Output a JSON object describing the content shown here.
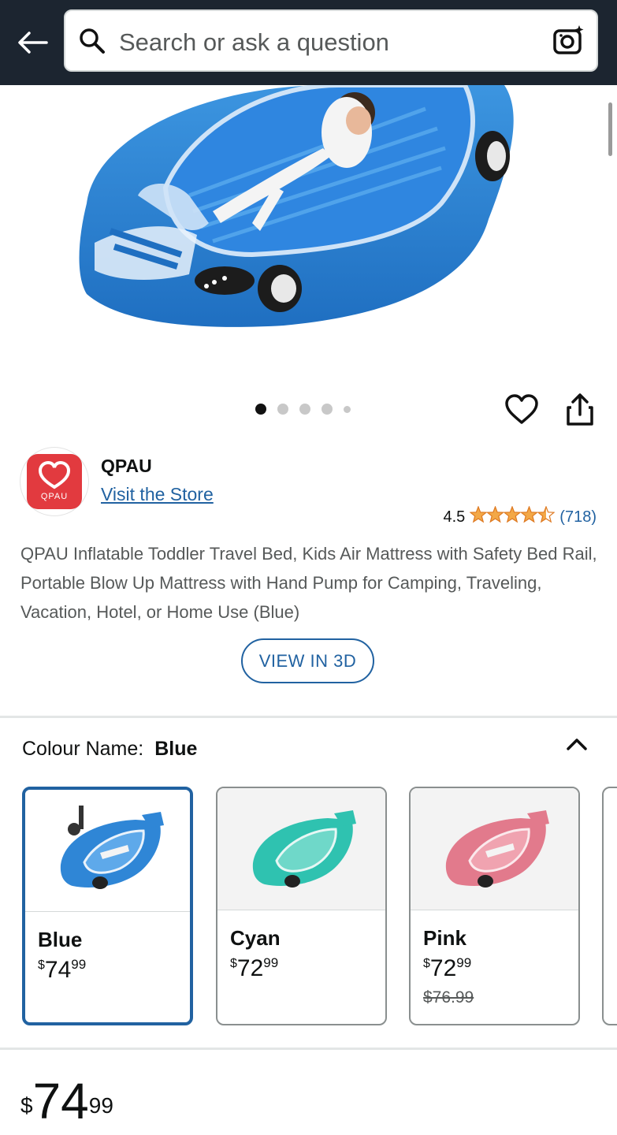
{
  "search": {
    "placeholder": "Search or ask a question"
  },
  "icons": {
    "back": "back-arrow-icon",
    "search": "search-icon",
    "camera": "camera-icon",
    "wishlist": "heart-icon",
    "share": "share-icon",
    "collapse": "chevron-up-icon"
  },
  "gallery": {
    "dots": 5,
    "active_index": 0
  },
  "store": {
    "brand": "QPAU",
    "logo_text": "QPAU",
    "visit_label": "Visit the Store"
  },
  "rating": {
    "value": "4.5",
    "stars": 4.5,
    "count": "(718)"
  },
  "product": {
    "title": "QPAU Inflatable Toddler Travel Bed, Kids Air Mattress with Safety Bed Rail, Portable Blow Up Mattress with Hand Pump for Camping, Traveling, Vacation, Hotel, or Home Use (Blue)",
    "view3d_label": "VIEW IN 3D"
  },
  "variants": {
    "label": "Colour Name:",
    "selected": "Blue",
    "options": [
      {
        "name": "Blue",
        "currency": "$",
        "whole": "74",
        "cents": "99",
        "was": "",
        "color": "#2f86d6"
      },
      {
        "name": "Cyan",
        "currency": "$",
        "whole": "72",
        "cents": "99",
        "was": "",
        "color": "#2fc2b0"
      },
      {
        "name": "Pink",
        "currency": "$",
        "whole": "72",
        "cents": "99",
        "was": "$76.99",
        "color": "#e27a8c"
      }
    ]
  },
  "price": {
    "currency": "$",
    "whole": "74",
    "cents": "99"
  },
  "colors": {
    "topbar": "#1c2530",
    "link": "#2162a1",
    "star": "#f3a847"
  }
}
